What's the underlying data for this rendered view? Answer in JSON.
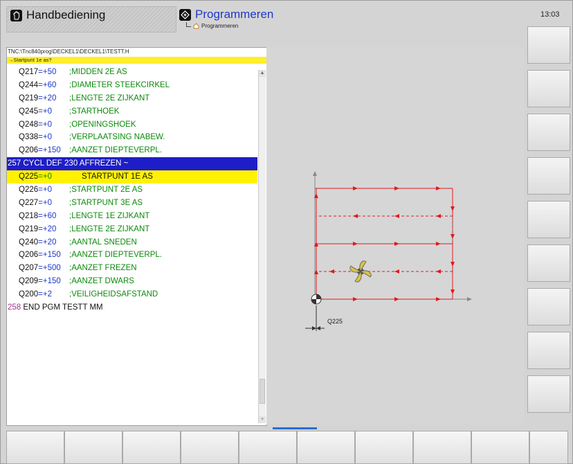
{
  "header": {
    "mode_left": "Handbediening",
    "mode_active": "Programmeren",
    "sub_mode": "Programmeren",
    "clock": "13:03"
  },
  "program": {
    "file_path": "TNC:\\Tnc840prog\\DECKEL1\\DECKEL1\\TESTT.H",
    "prompt": "→Startpunt 1e as?",
    "lines": [
      {
        "q": "Q217",
        "eq": "=+50",
        "comment": ";MIDDEN 2E AS"
      },
      {
        "q": "Q244",
        "eq": "=+60",
        "comment": ";DIAMETER STEEKCIRKEL"
      },
      {
        "q": "Q219",
        "eq": "=+20",
        "comment": ";LENGTE 2E ZIJKANT"
      },
      {
        "q": "Q245",
        "eq": "=+0",
        "comment": ";STARTHOEK"
      },
      {
        "q": "Q248",
        "eq": "=+0",
        "comment": ";OPENINGSHOEK"
      },
      {
        "q": "Q338",
        "eq": "=+0",
        "comment": ";VERPLAATSING NABEW."
      },
      {
        "q": "Q206",
        "eq": "=+150",
        "comment": ";AANZET DIEPTEVERPL."
      }
    ],
    "block_line": "257 CYCL DEF 230 AFFREZEN ~",
    "current_line": {
      "q": "Q225",
      "eq": "=+0",
      "comment": "STARTPUNT 1E AS"
    },
    "lines_after": [
      {
        "q": "Q226",
        "eq": "=+0",
        "comment": ";STARTPUNT 2E AS"
      },
      {
        "q": "Q227",
        "eq": "=+0",
        "comment": ";STARTPUNT 3E AS"
      },
      {
        "q": "Q218",
        "eq": "=+60",
        "comment": ";LENGTE 1E ZIJKANT"
      },
      {
        "q": "Q219",
        "eq": "=+20",
        "comment": ";LENGTE 2E ZIJKANT"
      },
      {
        "q": "Q240",
        "eq": "=+20",
        "comment": ";AANTAL SNEDEN"
      },
      {
        "q": "Q206",
        "eq": "=+150",
        "comment": ";AANZET DIEPTEVERPL."
      },
      {
        "q": "Q207",
        "eq": "=+500",
        "comment": ";AANZET FREZEN"
      },
      {
        "q": "Q209",
        "eq": "=+150",
        "comment": ";AANZET DWARS"
      },
      {
        "q": "Q200",
        "eq": "=+2",
        "comment": ";VEILIGHEIDSAFSTAND"
      }
    ],
    "end_line_nr": "258",
    "end_line_text": "END PGM TESTT MM"
  },
  "graphic": {
    "label": "Q225",
    "path_color": "#e0191e"
  },
  "colors": {
    "block_bg": "#1e1ec8",
    "current_bg": "#fff200",
    "prompt_bg": "#ffee2a",
    "mode_active_text": "#1c38c9"
  }
}
